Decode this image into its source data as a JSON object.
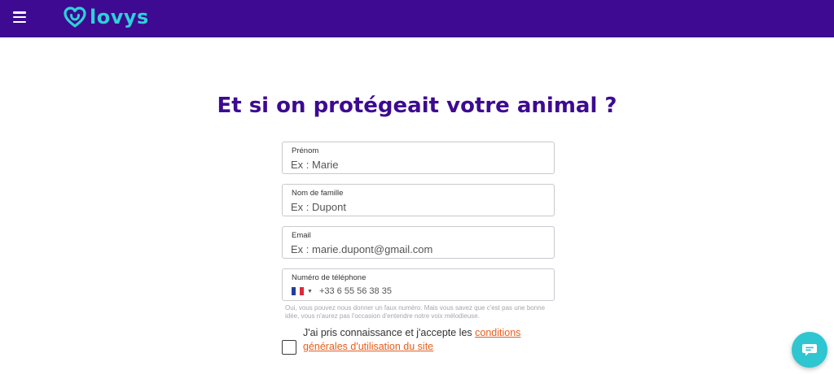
{
  "header": {
    "brand": "lovys",
    "background": "#3d0a91",
    "logo_color": "#2ed0d8",
    "menu_icon": "hamburger-menu-icon"
  },
  "main": {
    "title": "Et si on protégeait votre animal ?",
    "form": {
      "first_name": {
        "label": "Prénom",
        "placeholder": "Ex : Marie"
      },
      "last_name": {
        "label": "Nom de famille",
        "placeholder": "Ex : Dupont"
      },
      "email": {
        "label": "Email",
        "placeholder": "Ex : marie.dupont@gmail.com"
      },
      "phone": {
        "label": "Numéro de téléphone",
        "placeholder": "+33 6 55 56 38 35",
        "country_flag": "france-flag-icon"
      },
      "phone_hint": "Oui, vous pouvez nous donner un faux numéro. Mais vous savez que c'est pas une bonne idée, vous n'aurez pas l'occasion d'entendre notre voix mélodieuse.",
      "terms": {
        "text": "J'ai pris connaissance et j'accepte les ",
        "link": "conditions générales d'utilisation du site",
        "checked": false
      }
    }
  },
  "chat": {
    "icon": "chat-icon",
    "color": "#2ec6d0"
  },
  "colors": {
    "title": "#3d0a91",
    "link": "#e85d1c"
  }
}
